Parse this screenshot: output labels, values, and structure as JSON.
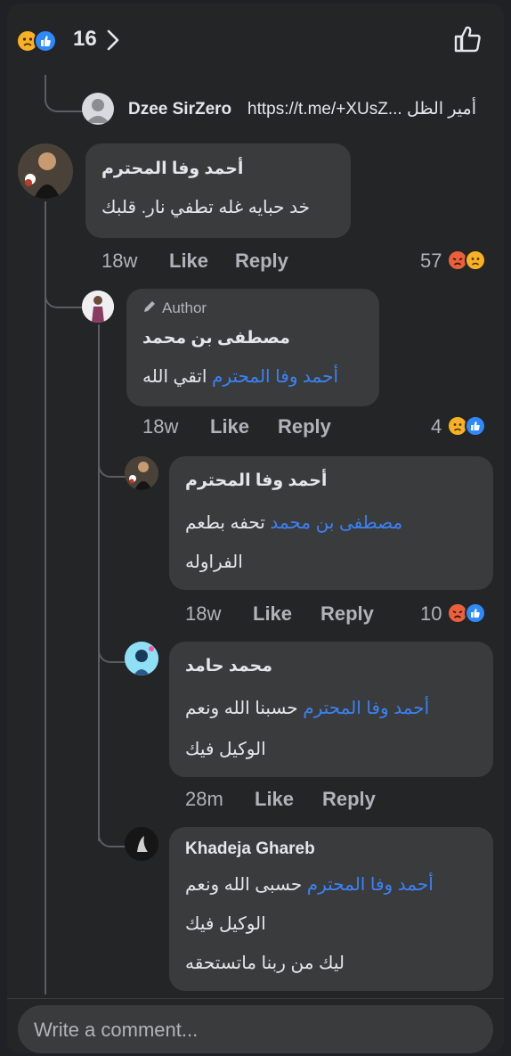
{
  "header": {
    "reaction_count": "16"
  },
  "comments": [
    {
      "name": "Dzee SirZero",
      "text": "https://t.me/+XUsZ... أمير الظل"
    },
    {
      "name": "أحمد وفا المحترم",
      "text": "خد حبايه غله تطفي نار. قلبك",
      "time": "18w",
      "like": "Like",
      "reply": "Reply",
      "reaction_count": "57"
    },
    {
      "author_badge": "Author",
      "name": "مصطفى بن محمد",
      "mention": "أحمد وفا المحترم",
      "text": "اتقي الله",
      "time": "18w",
      "like": "Like",
      "reply": "Reply",
      "reaction_count": "4"
    },
    {
      "name": "أحمد وفا المحترم",
      "mention": "مصطفى بن محمد",
      "text_line1": "تحفه بطعم",
      "text_line2": "الفراوله",
      "time": "18w",
      "like": "Like",
      "reply": "Reply",
      "reaction_count": "10"
    },
    {
      "name": "محمد حامد",
      "mention": "أحمد وفا المحترم",
      "text_line1": "حسبنا الله ونعم",
      "text_line2": "الوكيل فيك",
      "time": "28m",
      "like": "Like",
      "reply": "Reply"
    },
    {
      "name": "Khadeja Ghareb",
      "mention": "أحمد وفا المحترم",
      "text_line1": "حسبى الله ونعم",
      "text_line2": "الوكيل فيك",
      "text_line3": "ليك من ربنا ماتستحقه"
    }
  ],
  "composer": {
    "placeholder": "Write a comment..."
  },
  "colors": {
    "background": "#242527",
    "bubble": "#3a3b3c",
    "mention": "#3b82f6",
    "like_blue": "#2e89ff",
    "sad_yellow": "#f7b125",
    "angry_orange": "#e8603c"
  }
}
